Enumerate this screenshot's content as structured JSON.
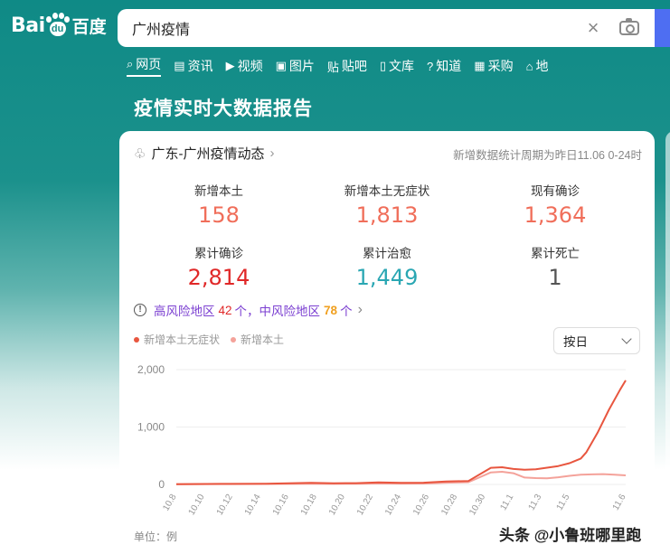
{
  "header": {
    "logo_text_left": "Bai",
    "logo_text_pad": "du",
    "logo_text_cn": "百度",
    "search_query": "广州疫情",
    "clear_glyph": "×"
  },
  "nav": [
    {
      "label": "网页",
      "icon": "search-icon",
      "glyph": "⌕",
      "active": true
    },
    {
      "label": "资讯",
      "icon": "news-icon",
      "glyph": "▤",
      "active": false
    },
    {
      "label": "视频",
      "icon": "video-icon",
      "glyph": "▶",
      "active": false
    },
    {
      "label": "图片",
      "icon": "image-icon",
      "glyph": "▣",
      "active": false
    },
    {
      "label": "贴吧",
      "icon": "tieba-icon",
      "glyph": "贴",
      "active": false
    },
    {
      "label": "文库",
      "icon": "doc-icon",
      "glyph": "▯",
      "active": false
    },
    {
      "label": "知道",
      "icon": "question-icon",
      "glyph": "?",
      "active": false
    },
    {
      "label": "采购",
      "icon": "cart-icon",
      "glyph": "▦",
      "active": false
    },
    {
      "label": "地",
      "icon": "map-icon",
      "glyph": "⌂",
      "active": false
    }
  ],
  "report_title": "疫情实时大数据报告",
  "card": {
    "title": "广东-广州疫情动态",
    "chevron": "›",
    "period": "新增数据统计周期为昨日11.06 0-24时",
    "stats": [
      {
        "label": "新增本土",
        "value": "158",
        "color": "#f06e5a"
      },
      {
        "label": "新增本土无症状",
        "value": "1,813",
        "color": "#f06e5a"
      },
      {
        "label": "现有确诊",
        "value": "1,364",
        "color": "#f06e5a"
      },
      {
        "label": "累计确诊",
        "value": "2,814",
        "color": "#e02828"
      },
      {
        "label": "累计治愈",
        "value": "1,449",
        "color": "#2aa7b3"
      },
      {
        "label": "累计死亡",
        "value": "1",
        "color": "#555555"
      }
    ],
    "risk": {
      "high_label": "高风险地区",
      "high_count": "42",
      "unit1": "个，",
      "mid_label": "中风险地区",
      "mid_count": "78",
      "unit2": "个",
      "chevron": "›"
    },
    "dropdown_label": "按日",
    "unit_label": "单位：例"
  },
  "chart_data": {
    "type": "line",
    "x": [
      "10.8",
      "10.10",
      "10.12",
      "10.14",
      "10.16",
      "10.18",
      "10.20",
      "10.22",
      "10.24",
      "10.26",
      "10.28",
      "10.30",
      "11.1",
      "11.3",
      "11.5",
      "11.6"
    ],
    "yticks": [
      "2,000",
      "1,000",
      "0"
    ],
    "ylim": [
      0,
      2000
    ],
    "series": [
      {
        "name": "新增本土无症状",
        "color": "#e8563f",
        "points": [
          [
            0,
            5
          ],
          [
            8,
            10
          ],
          [
            16,
            12
          ],
          [
            20,
            20
          ],
          [
            24,
            28
          ],
          [
            28,
            20
          ],
          [
            32,
            22
          ],
          [
            36,
            34
          ],
          [
            40,
            28
          ],
          [
            44,
            30
          ],
          [
            48,
            50
          ],
          [
            52,
            60
          ],
          [
            56,
            290
          ],
          [
            58,
            300
          ],
          [
            60,
            270
          ],
          [
            62,
            255
          ],
          [
            64,
            265
          ],
          [
            68,
            320
          ],
          [
            70,
            370
          ],
          [
            72,
            450
          ],
          [
            73,
            560
          ],
          [
            75,
            900
          ],
          [
            77,
            1300
          ],
          [
            79,
            1650
          ],
          [
            80,
            1813
          ]
        ]
      },
      {
        "name": "新增本土",
        "color": "#f4a29a",
        "points": [
          [
            0,
            3
          ],
          [
            8,
            6
          ],
          [
            16,
            8
          ],
          [
            20,
            10
          ],
          [
            24,
            12
          ],
          [
            28,
            10
          ],
          [
            32,
            12
          ],
          [
            36,
            15
          ],
          [
            40,
            14
          ],
          [
            44,
            16
          ],
          [
            48,
            30
          ],
          [
            52,
            40
          ],
          [
            56,
            210
          ],
          [
            58,
            220
          ],
          [
            60,
            195
          ],
          [
            62,
            120
          ],
          [
            64,
            110
          ],
          [
            66,
            105
          ],
          [
            68,
            125
          ],
          [
            70,
            150
          ],
          [
            72,
            170
          ],
          [
            74,
            175
          ],
          [
            76,
            180
          ],
          [
            78,
            170
          ],
          [
            80,
            158
          ]
        ]
      }
    ]
  },
  "watermark": "头条 @小鲁班哪里跑"
}
